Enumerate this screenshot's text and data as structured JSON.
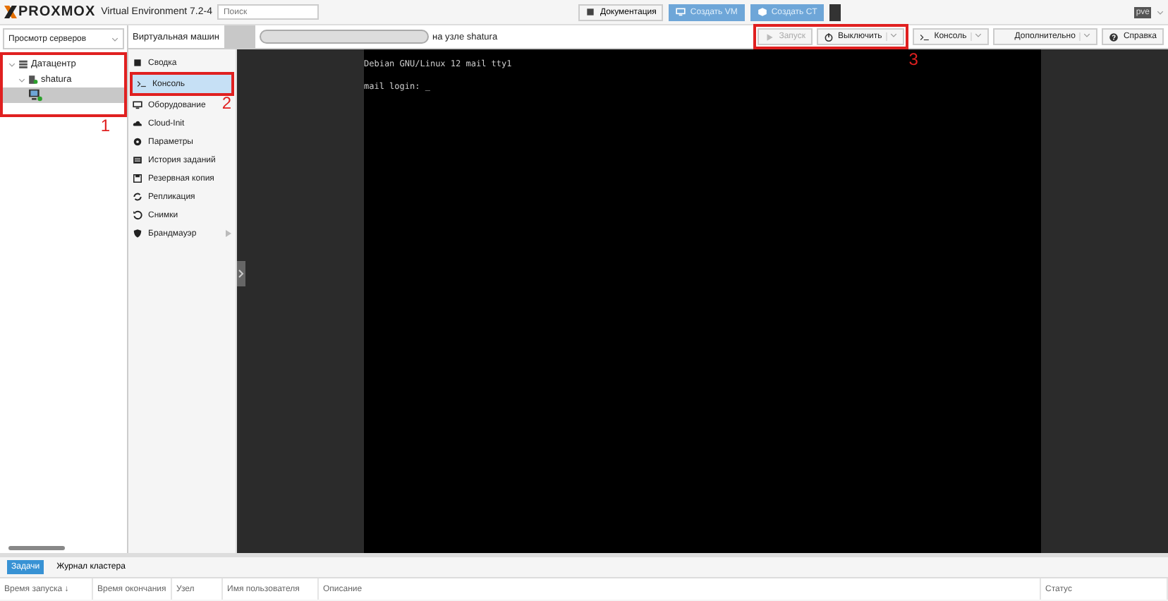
{
  "header": {
    "brand": "PROXMOX",
    "product": "Virtual Environment 7.2-4",
    "search": {
      "placeholder": "Поиск"
    },
    "buttons": [
      {
        "label": "Документация",
        "kind": "doc"
      },
      {
        "label": "Создать VM",
        "kind": "vm"
      },
      {
        "label": "Создать CT",
        "kind": "ct"
      }
    ],
    "user": "pve"
  },
  "sidebar": {
    "view": "Просмотр серверов",
    "tree": [
      {
        "label": "Датацентр",
        "kind": "datacenter",
        "selected": false,
        "expanded": true,
        "children": [
          {
            "label": "shatura",
            "kind": "node",
            "selected": false,
            "expanded": true,
            "children": [
              {
                "kind": "vm",
                "selected": true
              }
            ]
          }
        ]
      }
    ]
  },
  "content": {
    "title_prefix": "Виртуальная машин",
    "title_suffix": "на узле shatura",
    "toolbar": [
      {
        "label": "Запуск",
        "kind": "start",
        "disabled": true,
        "menu": false
      },
      {
        "label": "Выключить",
        "kind": "power",
        "disabled": false,
        "menu": true
      },
      {
        "label": "Консоль",
        "kind": "console",
        "disabled": false,
        "menu": true
      },
      {
        "label": "Дополнительно",
        "kind": "more",
        "disabled": false,
        "menu": true
      },
      {
        "label": "Справка",
        "kind": "help",
        "disabled": false,
        "menu": false
      }
    ],
    "nav": [
      {
        "label": "Сводка",
        "kind": "summary",
        "selected": false
      },
      {
        "label": "Консоль",
        "kind": "console",
        "selected": true
      },
      {
        "label": "Оборудование",
        "kind": "hardware",
        "selected": false
      },
      {
        "label": "Cloud-Init",
        "kind": "cloud",
        "selected": false
      },
      {
        "label": "Параметры",
        "kind": "options",
        "selected": false
      },
      {
        "label": "История заданий",
        "kind": "history",
        "selected": false
      },
      {
        "label": "Резервная копия",
        "kind": "backup",
        "selected": false
      },
      {
        "label": "Репликация",
        "kind": "replication",
        "selected": false
      },
      {
        "label": "Снимки",
        "kind": "snapshots",
        "selected": false
      },
      {
        "label": "Брандмауэр",
        "kind": "firewall",
        "selected": false,
        "submenu": true
      }
    ],
    "terminal": [
      "Debian GNU/Linux 12 mail tty1",
      "mail login: _"
    ]
  },
  "bottom": {
    "tabs": [
      {
        "label": "Задачи",
        "selected": true
      },
      {
        "label": "Журнал кластера",
        "selected": false
      }
    ],
    "columns": [
      "Время запуска ↓",
      "Время окончания",
      "Узел",
      "Имя пользователя",
      "Описание",
      "Статус"
    ]
  },
  "annotations": [
    {
      "label": "1",
      "kind": "tree"
    },
    {
      "label": "2",
      "kind": "nav"
    },
    {
      "label": "3",
      "kind": "toolbar"
    }
  ]
}
